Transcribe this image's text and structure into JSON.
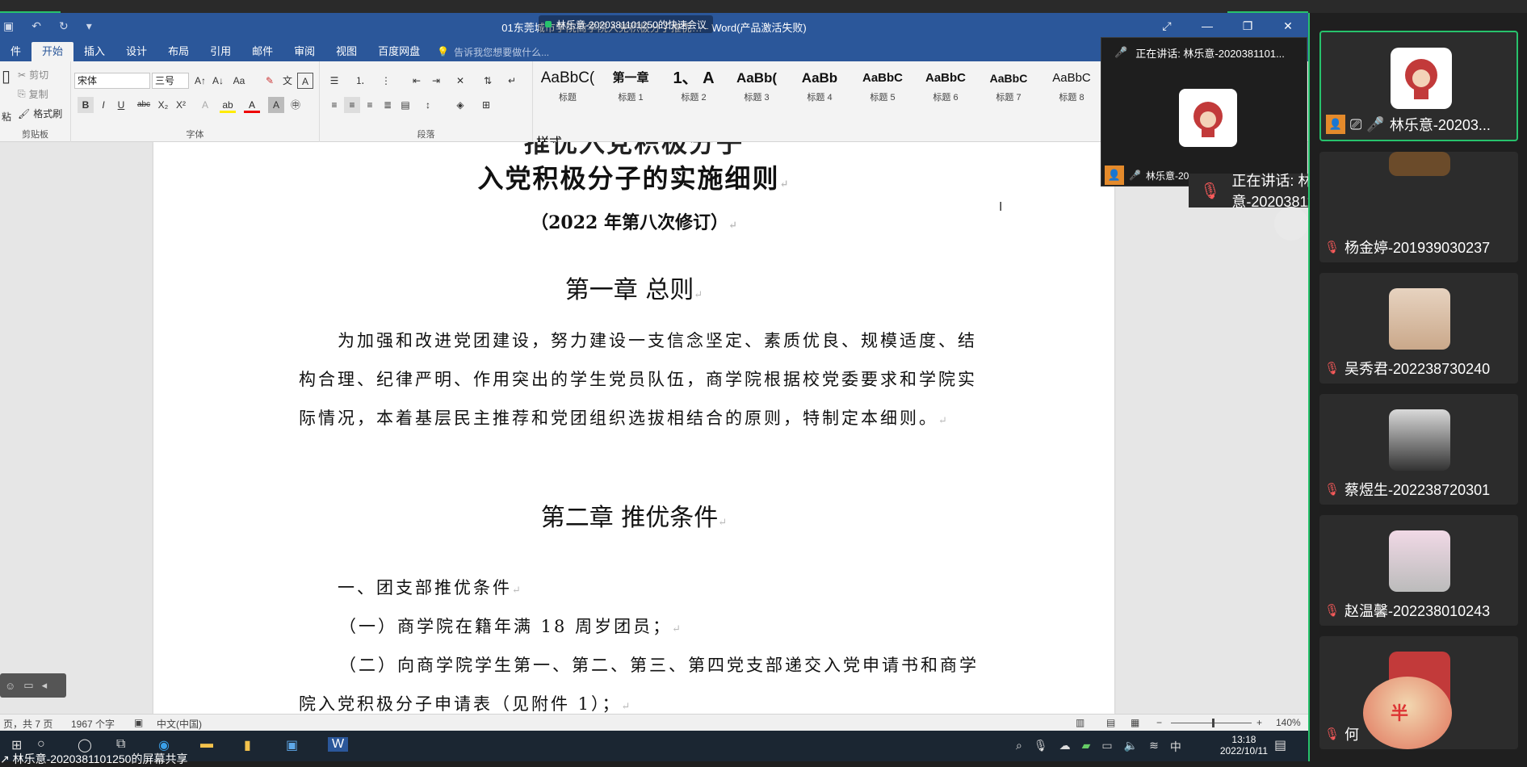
{
  "window": {
    "title": "01东莞城市学院商学院入党积极分子推优… - Word(产品激活失败)",
    "share_label": "林乐意-2020381101250的快速会议",
    "controls": [
      "⤢",
      "—",
      "❐",
      "✕"
    ]
  },
  "tabs": [
    "件",
    "开始",
    "插入",
    "设计",
    "布局",
    "引用",
    "邮件",
    "审阅",
    "视图",
    "百度网盘"
  ],
  "active_tab": "开始",
  "tell_me": "告诉我您想要做什么...",
  "ribbon": {
    "clipboard": {
      "cut": "剪切",
      "copy": "复制",
      "format_painter": "格式刷",
      "paste": "粘",
      "label": "剪贴板"
    },
    "font": {
      "name": "宋体",
      "size": "三号",
      "label": "字体",
      "bold": "B",
      "italic": "I",
      "underline": "U",
      "strike": "abc",
      "sub": "X₂",
      "sup": "X²"
    },
    "paragraph_label": "段落",
    "styles_label": "样式",
    "styles": [
      {
        "sample": "AaBbC(",
        "name": "标题"
      },
      {
        "sample": "第一章",
        "name": "标题 1"
      },
      {
        "sample": "1、 A",
        "name": "标题 2"
      },
      {
        "sample": "AaBb(",
        "name": "标题 3"
      },
      {
        "sample": "AaBb",
        "name": "标题 4"
      },
      {
        "sample": "AaBbC",
        "name": "标题 5"
      },
      {
        "sample": "AaBbC",
        "name": "标题 6"
      },
      {
        "sample": "AaBbC",
        "name": "标题 7"
      },
      {
        "sample": "AaBbC",
        "name": "标题 8"
      }
    ]
  },
  "document": {
    "title_line2": "入党积极分子的实施细则",
    "subtitle": "（2022 年第八次修订）",
    "chapter1": "第一章  总则",
    "para1": "为加强和改进党团建设，努力建设一支信念坚定、素质优良、规模适度、结构合理、纪律严明、作用突出的学生党员队伍，商学院根据校党委要求和学院实际情况，本着基层民主推荐和党团组织选拔相结合的原则，特制定本细则。",
    "chapter2": "第二章  推优条件",
    "item1": "一、团支部推优条件",
    "item1a": "（一）商学院在籍年满 18 周岁团员；",
    "item1b": "（二）向商学院学生第一、第二、第三、第四党支部递交入党申请书和商学",
    "item1c": "院入党积极分子申请表（见附件 1）；"
  },
  "status": {
    "page": "页，共 7 页",
    "words": "1967 个字",
    "lang": "中文(中国)",
    "zoom": "140%",
    "zoom_minus": "−",
    "zoom_plus": "+"
  },
  "speaker_panel": {
    "header": "正在讲话: 林乐意-2020381101...",
    "footer": "林乐意-20"
  },
  "speaking_float": "正在讲话: 林乐意-2020381101...",
  "participants": [
    {
      "name": "林乐意-20203...",
      "active": true,
      "muted": false
    },
    {
      "name": "杨金婷-201939030237",
      "active": false,
      "muted": true
    },
    {
      "name": "吴秀君-202238730240",
      "active": false,
      "muted": true
    },
    {
      "name": "蔡煜生-202238720301",
      "active": false,
      "muted": true
    },
    {
      "name": "赵温馨-202238010243",
      "active": false,
      "muted": true
    },
    {
      "name": "何",
      "active": false,
      "muted": true
    }
  ],
  "taskbar": {
    "share_text": "林乐意-2020381101250的屏幕共享",
    "time": "13:18",
    "date": "2022/10/11",
    "ime": "中",
    "ime_badge": "半"
  },
  "colors": {
    "word_blue": "#2b579a",
    "meeting_green": "#27c26c",
    "sidebar_bg": "#1f1f1f"
  }
}
